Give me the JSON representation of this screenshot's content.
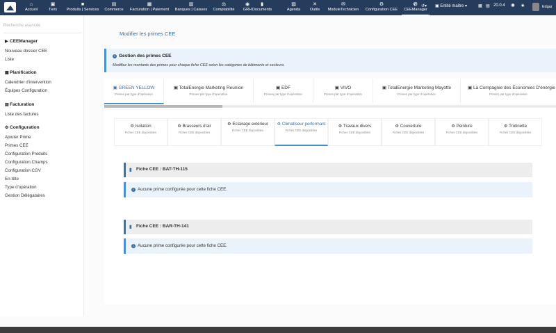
{
  "nav": {
    "items": [
      {
        "label": "Accueil",
        "icon": "⌂"
      },
      {
        "label": "Tiers",
        "icon": "▣"
      },
      {
        "label": "Produits | Services",
        "icon": "■"
      },
      {
        "label": "Commerce",
        "icon": "▤"
      },
      {
        "label": "Facturation | Paiement",
        "icon": "▦"
      },
      {
        "label": "Banques | Caisses",
        "icon": "▥"
      },
      {
        "label": "Comptabilité",
        "icon": "⚖"
      },
      {
        "label": "GRH",
        "icon": "◉"
      },
      {
        "label": "Documents",
        "icon": "▮"
      },
      {
        "label": "Agenda",
        "icon": "▨"
      },
      {
        "label": "Outils",
        "icon": "✕"
      },
      {
        "label": "ModuleTechnicien",
        "icon": "✉"
      },
      {
        "label": "Configuration CEE",
        "icon": "⚙"
      },
      {
        "label": "CEEManager",
        "icon": "⚙"
      }
    ],
    "entity": "Entité maître",
    "version": "20.0.4",
    "user": "Edgar"
  },
  "sidebar": {
    "search_placeholder": "Recherche avancée",
    "sections": [
      {
        "title": "CEEManager",
        "icon": "▶",
        "links": [
          "Nouveau dossier CEE",
          "Liste"
        ]
      },
      {
        "title": "Planification",
        "icon": "▦",
        "links": [
          "Calendrier d'intervention",
          "Équipes Configuration"
        ]
      },
      {
        "title": "Facturation",
        "icon": "▤",
        "links": [
          "Liste des factures"
        ]
      },
      {
        "title": "Configuration",
        "icon": "⚙",
        "links": [
          "Ajouter Prime",
          "Primes CEE",
          "Configuration Produits",
          "Configuration Champs",
          "Configuration CGV",
          "En-tête",
          "Type d'opération",
          "Gestion Délégataires"
        ]
      }
    ]
  },
  "page": {
    "title": "Modifier les primes CEE",
    "info_title": "Gestion des primes CEE",
    "info_desc": "Modifiez les montants des primes pour chaque fiche CEE selon les catégories de bâtiments et secteurs."
  },
  "delegataire_tabs": [
    {
      "label": "GREEN YELLOW",
      "sub": "Primes par type d'opération"
    },
    {
      "label": "TotalEnergie Marketing Reunion",
      "sub": "Primes par type d'opération"
    },
    {
      "label": "EDF",
      "sub": "Primes par type d'opération"
    },
    {
      "label": "VIVO",
      "sub": "Primes par type d'opération"
    },
    {
      "label": "TotalEnergie Marketing Mayotte",
      "sub": "Primes par type d'opération"
    },
    {
      "label": "La Compagnie des Économies D'énergie",
      "sub": "Primes par type d'opération"
    }
  ],
  "category_tabs": [
    {
      "label": "Isolation",
      "sub": "Fiches CEE disponibles"
    },
    {
      "label": "Brasseurs d'air",
      "sub": "Fiches CEE disponibles"
    },
    {
      "label": "Eclairage extérieur",
      "sub": "Fiches CEE disponibles"
    },
    {
      "label": "Climatiseur performant",
      "sub": "Fiches CEE disponibles"
    },
    {
      "label": "Travaux divers",
      "sub": "Fiches CEE disponibles"
    },
    {
      "label": "Couverture",
      "sub": "Fiches CEE disponibles"
    },
    {
      "label": "Peinture",
      "sub": "Fiches CEE disponibles"
    },
    {
      "label": "Trotinette",
      "sub": "Fiches CEE disponibles"
    }
  ],
  "fiches": [
    {
      "title": "Fiche CEE : BAT-TH-115",
      "note": "Aucune prime configurée pour cette fiche CEE."
    },
    {
      "title": "Fiche CEE : BAR-TH-141",
      "note": "Aucune prime configurée pour cette fiche CEE."
    }
  ]
}
